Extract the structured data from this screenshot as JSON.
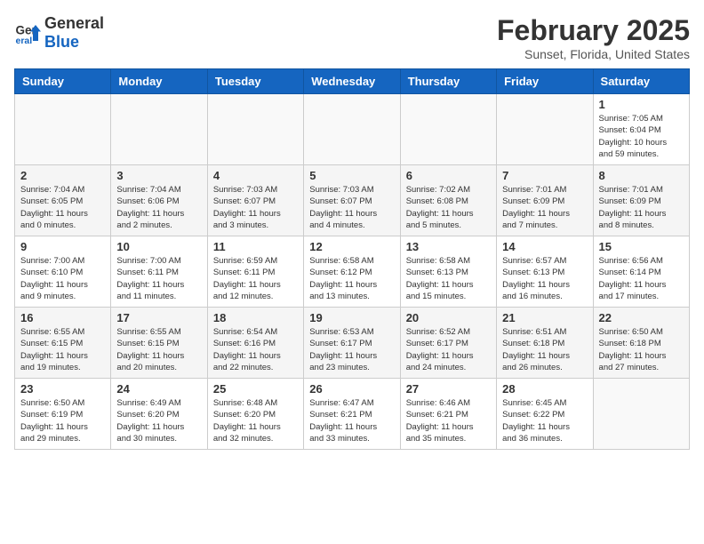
{
  "header": {
    "logo_general": "General",
    "logo_blue": "Blue",
    "month_title": "February 2025",
    "location": "Sunset, Florida, United States"
  },
  "days_of_week": [
    "Sunday",
    "Monday",
    "Tuesday",
    "Wednesday",
    "Thursday",
    "Friday",
    "Saturday"
  ],
  "weeks": [
    [
      {
        "day": "",
        "info": ""
      },
      {
        "day": "",
        "info": ""
      },
      {
        "day": "",
        "info": ""
      },
      {
        "day": "",
        "info": ""
      },
      {
        "day": "",
        "info": ""
      },
      {
        "day": "",
        "info": ""
      },
      {
        "day": "1",
        "info": "Sunrise: 7:05 AM\nSunset: 6:04 PM\nDaylight: 10 hours\nand 59 minutes."
      }
    ],
    [
      {
        "day": "2",
        "info": "Sunrise: 7:04 AM\nSunset: 6:05 PM\nDaylight: 11 hours\nand 0 minutes."
      },
      {
        "day": "3",
        "info": "Sunrise: 7:04 AM\nSunset: 6:06 PM\nDaylight: 11 hours\nand 2 minutes."
      },
      {
        "day": "4",
        "info": "Sunrise: 7:03 AM\nSunset: 6:07 PM\nDaylight: 11 hours\nand 3 minutes."
      },
      {
        "day": "5",
        "info": "Sunrise: 7:03 AM\nSunset: 6:07 PM\nDaylight: 11 hours\nand 4 minutes."
      },
      {
        "day": "6",
        "info": "Sunrise: 7:02 AM\nSunset: 6:08 PM\nDaylight: 11 hours\nand 5 minutes."
      },
      {
        "day": "7",
        "info": "Sunrise: 7:01 AM\nSunset: 6:09 PM\nDaylight: 11 hours\nand 7 minutes."
      },
      {
        "day": "8",
        "info": "Sunrise: 7:01 AM\nSunset: 6:09 PM\nDaylight: 11 hours\nand 8 minutes."
      }
    ],
    [
      {
        "day": "9",
        "info": "Sunrise: 7:00 AM\nSunset: 6:10 PM\nDaylight: 11 hours\nand 9 minutes."
      },
      {
        "day": "10",
        "info": "Sunrise: 7:00 AM\nSunset: 6:11 PM\nDaylight: 11 hours\nand 11 minutes."
      },
      {
        "day": "11",
        "info": "Sunrise: 6:59 AM\nSunset: 6:11 PM\nDaylight: 11 hours\nand 12 minutes."
      },
      {
        "day": "12",
        "info": "Sunrise: 6:58 AM\nSunset: 6:12 PM\nDaylight: 11 hours\nand 13 minutes."
      },
      {
        "day": "13",
        "info": "Sunrise: 6:58 AM\nSunset: 6:13 PM\nDaylight: 11 hours\nand 15 minutes."
      },
      {
        "day": "14",
        "info": "Sunrise: 6:57 AM\nSunset: 6:13 PM\nDaylight: 11 hours\nand 16 minutes."
      },
      {
        "day": "15",
        "info": "Sunrise: 6:56 AM\nSunset: 6:14 PM\nDaylight: 11 hours\nand 17 minutes."
      }
    ],
    [
      {
        "day": "16",
        "info": "Sunrise: 6:55 AM\nSunset: 6:15 PM\nDaylight: 11 hours\nand 19 minutes."
      },
      {
        "day": "17",
        "info": "Sunrise: 6:55 AM\nSunset: 6:15 PM\nDaylight: 11 hours\nand 20 minutes."
      },
      {
        "day": "18",
        "info": "Sunrise: 6:54 AM\nSunset: 6:16 PM\nDaylight: 11 hours\nand 22 minutes."
      },
      {
        "day": "19",
        "info": "Sunrise: 6:53 AM\nSunset: 6:17 PM\nDaylight: 11 hours\nand 23 minutes."
      },
      {
        "day": "20",
        "info": "Sunrise: 6:52 AM\nSunset: 6:17 PM\nDaylight: 11 hours\nand 24 minutes."
      },
      {
        "day": "21",
        "info": "Sunrise: 6:51 AM\nSunset: 6:18 PM\nDaylight: 11 hours\nand 26 minutes."
      },
      {
        "day": "22",
        "info": "Sunrise: 6:50 AM\nSunset: 6:18 PM\nDaylight: 11 hours\nand 27 minutes."
      }
    ],
    [
      {
        "day": "23",
        "info": "Sunrise: 6:50 AM\nSunset: 6:19 PM\nDaylight: 11 hours\nand 29 minutes."
      },
      {
        "day": "24",
        "info": "Sunrise: 6:49 AM\nSunset: 6:20 PM\nDaylight: 11 hours\nand 30 minutes."
      },
      {
        "day": "25",
        "info": "Sunrise: 6:48 AM\nSunset: 6:20 PM\nDaylight: 11 hours\nand 32 minutes."
      },
      {
        "day": "26",
        "info": "Sunrise: 6:47 AM\nSunset: 6:21 PM\nDaylight: 11 hours\nand 33 minutes."
      },
      {
        "day": "27",
        "info": "Sunrise: 6:46 AM\nSunset: 6:21 PM\nDaylight: 11 hours\nand 35 minutes."
      },
      {
        "day": "28",
        "info": "Sunrise: 6:45 AM\nSunset: 6:22 PM\nDaylight: 11 hours\nand 36 minutes."
      },
      {
        "day": "",
        "info": ""
      }
    ]
  ]
}
